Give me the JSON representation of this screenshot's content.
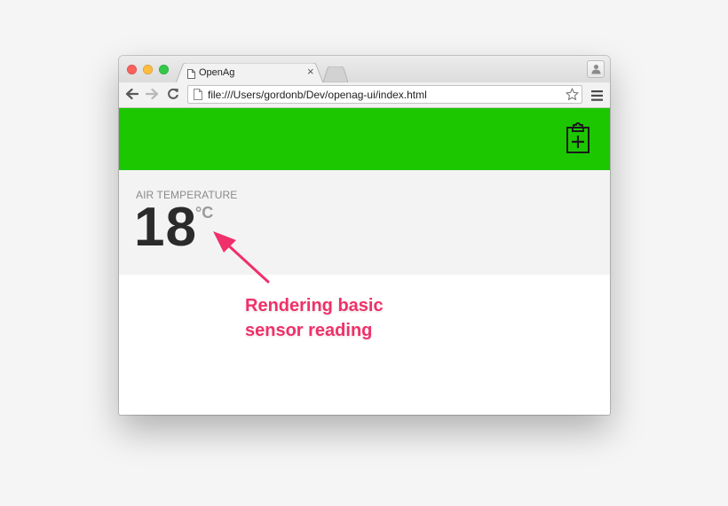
{
  "browser": {
    "tab": {
      "title": "OpenAg",
      "close_glyph": "×"
    },
    "address_bar": {
      "url": "file:///Users/gordonb/Dev/openag-ui/index.html"
    }
  },
  "app": {
    "header_color": "#1cc700",
    "header_icon": "clipboard-plus-icon",
    "sensor": {
      "label": "AIR TEMPERATURE",
      "value": "18",
      "unit": "°C"
    }
  },
  "annotation": {
    "line1": "Rendering basic",
    "line2": "sensor reading",
    "color": "#f0306a"
  }
}
